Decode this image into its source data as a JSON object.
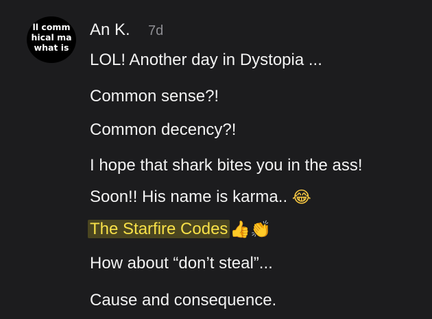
{
  "comment": {
    "avatar_text": [
      "ll comm",
      "hical ma",
      "what is"
    ],
    "author": "An K.",
    "time": "7d",
    "lines": [
      "LOL! Another day in Dystopia ...",
      "Common sense?!",
      "Common decency?!",
      "I hope that shark bites you in the ass!",
      "Soon!! His name is karma.. ",
      "The Starfire Codes",
      "How about “don’t steal”...",
      "Cause and consequence."
    ],
    "emojis": {
      "laughing": "😂",
      "thumbs_up": "👍",
      "clapping": "👏"
    }
  },
  "colors": {
    "background": "#1c1c1e",
    "text": "#f2f2f2",
    "muted": "#8e8e93",
    "link_text": "#f7e048",
    "link_highlight": "#4a4520"
  }
}
